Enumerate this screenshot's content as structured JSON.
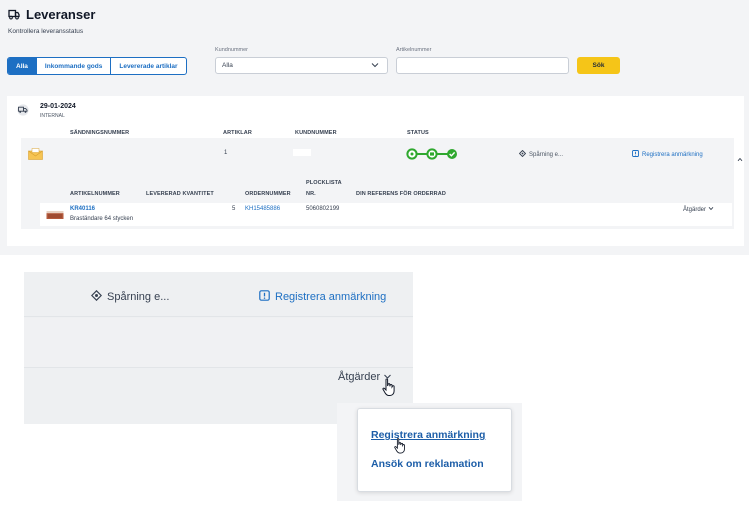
{
  "page": {
    "title": "Leveranser",
    "subtitle": "Kontrollera leveransstatus"
  },
  "filters": {
    "tabs": [
      {
        "label": "Alla",
        "active": true
      },
      {
        "label": "Inkommande gods",
        "active": false
      },
      {
        "label": "Levererade artiklar",
        "active": false
      }
    ],
    "customer_label": "Kundnummer",
    "customer_value": "Alla",
    "article_label": "Artikelnummer",
    "article_value": "",
    "search_button": "Sök"
  },
  "shipment": {
    "date": "29-01-2024",
    "type": "INTERNAL",
    "columns": {
      "shipment_number": "SÄNDNINGSNUMMER",
      "articles": "ARTIKLAR",
      "customer_number": "KUNDNUMMER",
      "status": "STATUS"
    },
    "row": {
      "articles": "1",
      "tracking": "Spårning e...",
      "register": "Registrera anmärkning"
    },
    "sub_columns": {
      "article_number": "ARTIKELNUMMER",
      "delivered_qty": "LEVERERAD KVANTITET",
      "order_number": "ORDERNUMMER",
      "pick_list_1": "PLOCKLISTA",
      "pick_list_2": "NR.",
      "your_ref": "DIN REFERENS FÖR ORDERRAD"
    },
    "sub_row": {
      "article_number": "KR40116",
      "description": "Braständare 64 stycken",
      "delivered_qty": "5",
      "order_number": "KH15485886",
      "pick_list": "5060802199",
      "actions": "Åtgärder"
    }
  },
  "zoom": {
    "tracking": "Spårning e...",
    "register": "Registrera anmärkning",
    "actions": "Åtgärder",
    "menu": [
      "Registrera anmärkning",
      "Ansök om reklamation"
    ]
  },
  "colors": {
    "primary_blue": "#1d6fc3",
    "link_blue": "#1d5ea8",
    "yellow": "#f5c518",
    "status_green": "#2fa82f",
    "panel_gray": "#f3f4f6"
  }
}
